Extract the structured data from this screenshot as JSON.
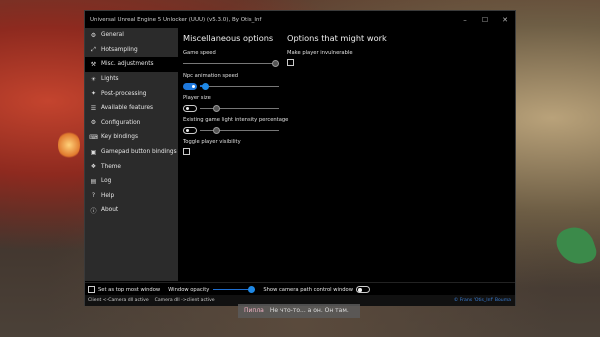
{
  "window": {
    "title": "Universal Unreal Engine 5 Unlocker (UUU) (v5.3.0), By Otis_Inf",
    "controls": [
      "minimize-icon",
      "maximize-icon",
      "close-icon"
    ]
  },
  "sidebar": {
    "items": [
      {
        "label": "General",
        "icon": "gear-icon",
        "active": false
      },
      {
        "label": "Hotsampling",
        "icon": "resize-icon",
        "active": false
      },
      {
        "label": "Misc. adjustments",
        "icon": "tools-icon",
        "active": true
      },
      {
        "label": "Lights",
        "icon": "lightbulb-icon",
        "active": false
      },
      {
        "label": "Post-processing",
        "icon": "sparkle-icon",
        "active": false
      },
      {
        "label": "Available features",
        "icon": "list-icon",
        "active": false
      },
      {
        "label": "Configuration",
        "icon": "settings-icon",
        "active": false
      },
      {
        "label": "Key bindings",
        "icon": "key-icon",
        "active": false
      },
      {
        "label": "Gamepad button bindings",
        "icon": "gamepad-icon",
        "active": false
      },
      {
        "label": "Theme",
        "icon": "palette-icon",
        "active": false
      },
      {
        "label": "Log",
        "icon": "log-icon",
        "active": false
      },
      {
        "label": "Help",
        "icon": "help-icon",
        "active": false
      },
      {
        "label": "About",
        "icon": "info-icon",
        "active": false
      }
    ]
  },
  "misc": {
    "heading": "Miscellaneous options",
    "game_speed_label": "Game speed",
    "game_speed_value": 0.98,
    "npc_anim_label": "Npc animation speed",
    "npc_anim_enabled": true,
    "npc_anim_value": 0.0,
    "player_size_label": "Player size",
    "player_size_enabled": false,
    "player_size_value": 0.0,
    "light_intensity_label": "Existing game light intensity percentage",
    "light_intensity_enabled": false,
    "light_intensity_value": 0.0,
    "toggle_visibility_label": "Toggle player visibility",
    "toggle_visibility_checked": false
  },
  "options": {
    "heading": "Options that might work",
    "invulnerable_label": "Make player invulnerable",
    "invulnerable_checked": false
  },
  "bottom": {
    "top_most_label": "Set as top most window",
    "top_most_checked": false,
    "opacity_label": "Window opacity",
    "opacity_value": 1.0,
    "camera_path_label": "Show camera path control window",
    "camera_path_enabled": false
  },
  "status": {
    "client_text": "Client <-Camera dll active",
    "camera_text": "Camera dll ->client active",
    "link_text": "© Frans 'Otis_Inf' Bouma"
  },
  "game": {
    "subtitle_speaker": "Пипла",
    "subtitle_text": "Не что-то... а он. Он там."
  },
  "colors": {
    "accent": "#1e88e5",
    "sidebar_bg": "#2b2b2b",
    "window_bg": "#000000"
  }
}
